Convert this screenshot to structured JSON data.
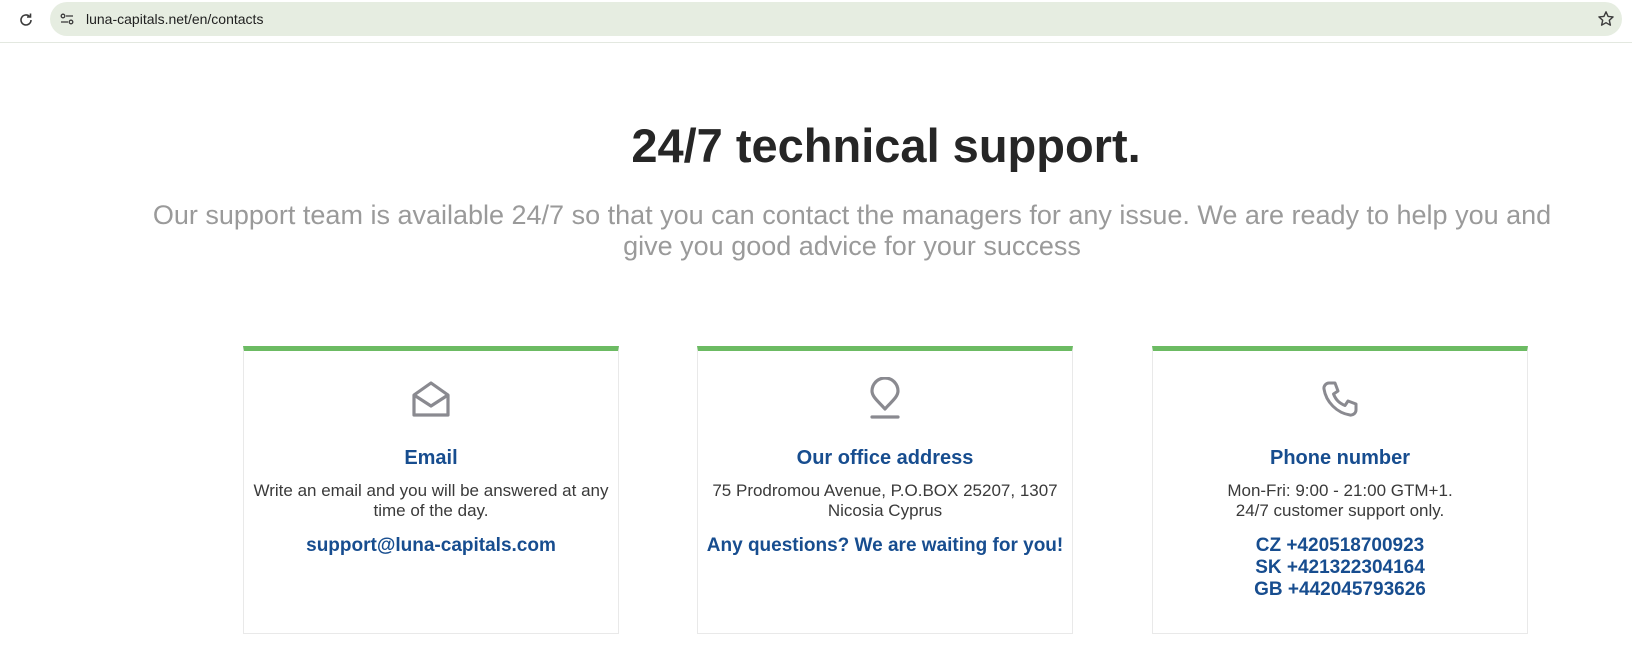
{
  "browser": {
    "url": "luna-capitals.net/en/contacts"
  },
  "hero": {
    "title": "24/7 technical support.",
    "subtitle": "Our support team is available 24/7 so that you can contact the managers for any issue. We are ready to help you and give you good advice for your success"
  },
  "cards": {
    "email": {
      "icon": "envelope-open-icon",
      "title": "Email",
      "text": "Write an email and you will be answered at any time of the day.",
      "highlight": "support@luna-capitals.com"
    },
    "office": {
      "icon": "location-pin-icon",
      "title": "Our office address",
      "text": "75 Prodromou Avenue, P.O.BOX 25207, 1307 Nicosia Cyprus",
      "highlight": "Any questions? We are waiting for you!"
    },
    "phone": {
      "icon": "phone-icon",
      "title": "Phone number",
      "text_line1": "Mon-Fri: 9:00 - 21:00 GTM+1.",
      "text_line2": "24/7 customer support only.",
      "numbers": [
        "CZ +420518700923",
        "SK +421322304164",
        "GB +442045793626"
      ]
    }
  },
  "colors": {
    "accent_bar": "#6cbb63",
    "heading_blue": "#174d8f",
    "title_dark": "#262626",
    "subtitle_gray": "#9a9a9a",
    "omnibox_bg": "#e6ede1"
  }
}
